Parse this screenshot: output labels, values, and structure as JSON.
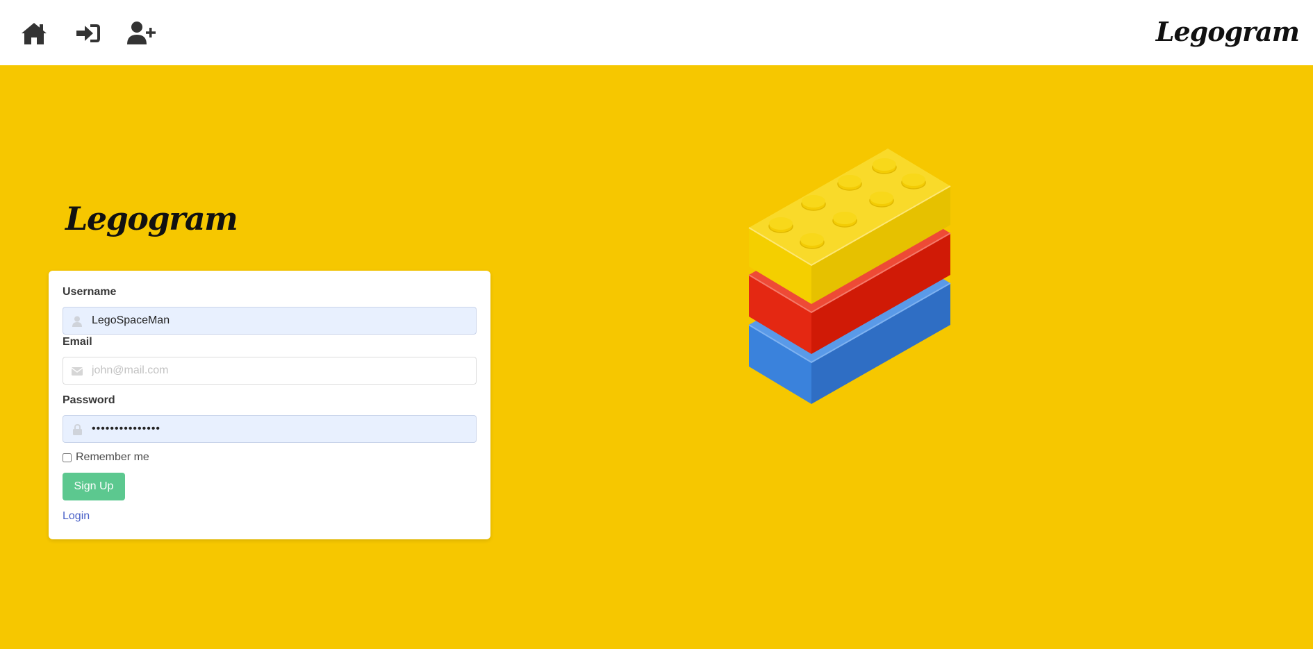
{
  "navbar": {
    "icons": [
      {
        "name": "home-icon"
      },
      {
        "name": "sign-in-icon"
      },
      {
        "name": "user-plus-icon"
      }
    ],
    "brand": "Legogram"
  },
  "hero": {
    "brand": "Legogram",
    "illustration": "stacked-lego-bricks",
    "brick_colors": [
      "#f7d10f",
      "#e02010",
      "#3a82dc"
    ]
  },
  "form": {
    "username": {
      "label": "Username",
      "value": "LegoSpaceMan",
      "placeholder": "",
      "icon": "user-icon"
    },
    "email": {
      "label": "Email",
      "value": "",
      "placeholder": "john@mail.com",
      "icon": "envelope-icon"
    },
    "password": {
      "label": "Password",
      "value": "•••••••••••••••",
      "icon": "lock-icon"
    },
    "remember_label": "Remember me",
    "remember_checked": false,
    "submit_label": "Sign Up",
    "login_link": "Login"
  },
  "colors": {
    "background": "#f6c700",
    "primary_button": "#5cc88f",
    "link": "#485fc7",
    "autofill": "#e8f0fe"
  }
}
